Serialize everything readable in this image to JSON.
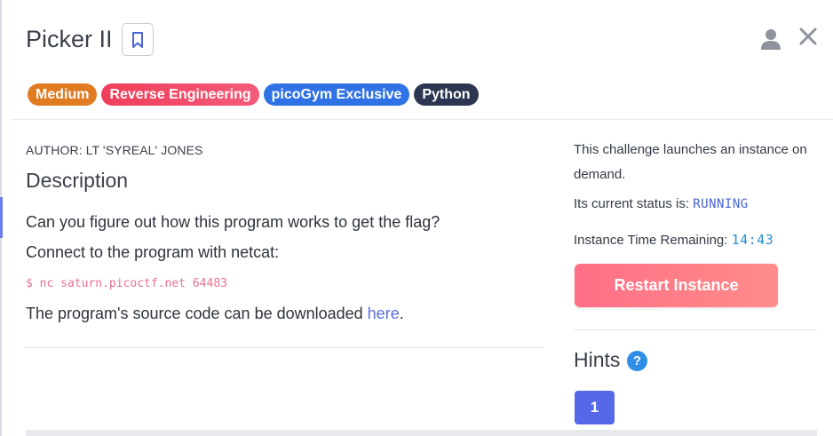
{
  "header": {
    "title": "Picker II",
    "icons": {
      "bookmark": "bookmark-icon",
      "user": "user-icon",
      "close": "close-icon"
    }
  },
  "tags": [
    {
      "label": "Medium",
      "color": "#e07b22"
    },
    {
      "label": "Reverse Engineering",
      "color": "#ef3e5a"
    },
    {
      "label": "picoGym Exclusive",
      "color": "#2f72e6"
    },
    {
      "label": "Python",
      "color": "#2c3650"
    }
  ],
  "main": {
    "author": "AUTHOR: LT 'SYREAL' JONES",
    "description_heading": "Description",
    "line1": "Can you figure out how this program works to get the flag?",
    "line2": "Connect to the program with netcat:",
    "command": "$ nc saturn.picoctf.net 64483",
    "source_prefix": "The program's source code can be downloaded ",
    "source_link": "here",
    "source_suffix": "."
  },
  "instance": {
    "info_line1": "This challenge launches an instance on",
    "info_line2": "demand.",
    "status_label": "Its current status is: ",
    "status_value": "RUNNING",
    "time_label": "Instance Time Remaining: ",
    "time_value": "14:43",
    "restart_label": "Restart Instance"
  },
  "hints": {
    "heading": "Hints",
    "help_glyph": "?",
    "items": [
      "1"
    ]
  },
  "colors": {
    "accent": "#5569e8",
    "restart": "#ff7a88",
    "status": "#4a63d6",
    "timer": "#2a8fd6",
    "command": "#e8718f"
  }
}
